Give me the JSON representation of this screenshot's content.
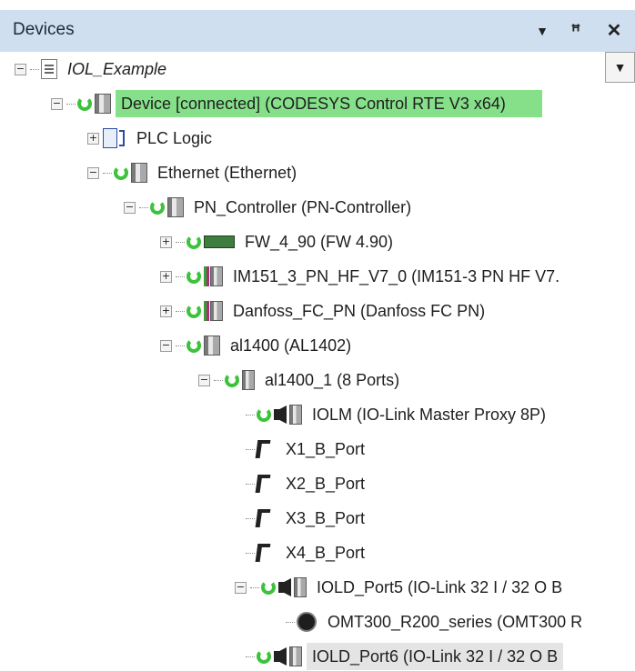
{
  "panel": {
    "title": "Devices",
    "dropdown_glyph": "▼",
    "pin_glyph": "ꟸ",
    "close_glyph": "✕"
  },
  "tree": {
    "combo_glyph": "▼",
    "rows": [
      {
        "label": "IOL_Example",
        "expander": "−"
      },
      {
        "label": "Device [connected] (CODESYS Control RTE V3 x64)",
        "expander": "−"
      },
      {
        "label": "PLC Logic",
        "expander": "+"
      },
      {
        "label": "Ethernet (Ethernet)",
        "expander": "−"
      },
      {
        "label": "PN_Controller (PN-Controller)",
        "expander": "−"
      },
      {
        "label": "FW_4_90 (FW 4.90)",
        "expander": "+"
      },
      {
        "label": "IM151_3_PN_HF_V7_0 (IM151-3 PN HF V7.",
        "expander": "+"
      },
      {
        "label": "Danfoss_FC_PN (Danfoss FC PN)",
        "expander": "+"
      },
      {
        "label": "al1400 (AL1402)",
        "expander": "−"
      },
      {
        "label": "al1400_1 (8 Ports)",
        "expander": "−"
      },
      {
        "label": "IOLM (IO-Link Master Proxy 8P)"
      },
      {
        "label": "X1_B_Port"
      },
      {
        "label": "X2_B_Port"
      },
      {
        "label": "X3_B_Port"
      },
      {
        "label": "X4_B_Port"
      },
      {
        "label": "IOLD_Port5 (IO-Link 32 I / 32 O B",
        "expander": "−"
      },
      {
        "label": "OMT300_R200_series (OMT300 R"
      },
      {
        "label": "IOLD_Port6 (IO-Link 32 I / 32 O B"
      }
    ]
  },
  "colors": {
    "titlebar_bg": "#cfdff0",
    "connected_highlight": "#86e08a",
    "sync_icon": "#3cc23c"
  },
  "icons": [
    "project-icon",
    "sync-icon",
    "device-icon",
    "plc-logic-icon",
    "firmware-icon",
    "profinet-plug-icon",
    "io-link-master-icon",
    "port-icon",
    "sensor-icon"
  ]
}
